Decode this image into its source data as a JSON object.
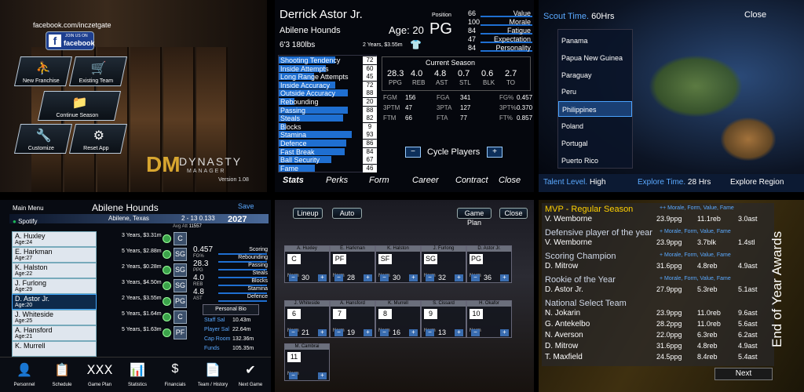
{
  "panel1": {
    "url": "facebook.com/inczetgate",
    "join": "JOIN US ON",
    "fb": "facebook",
    "buttons": [
      "New Franchise",
      "Existing Team",
      "Continue Season",
      "Customize",
      "Reset App"
    ],
    "logo_word": "DYNASTY",
    "logo_sub": "MANAGER",
    "version": "Version 1.08"
  },
  "panel2": {
    "name": "Derrick Astor Jr.",
    "team": "Abilene Hounds",
    "age_label": "Age:",
    "age": "20",
    "pos_label": "Position",
    "pos": "PG",
    "height_weight": "6'3  180lbs",
    "contract": "2 Years, $3.55m",
    "ratings": [
      {
        "label": "Value",
        "value": "66"
      },
      {
        "label": "Morale",
        "value": "100"
      },
      {
        "label": "Fatigue",
        "value": "84"
      },
      {
        "label": "Expectation",
        "value": "47"
      },
      {
        "label": "Personality",
        "value": "84"
      }
    ],
    "skills": [
      {
        "label": "Shooting Tendency",
        "value": 72
      },
      {
        "label": "Inside Attempts",
        "value": 60
      },
      {
        "label": "Long Range Attempts",
        "value": 45
      },
      {
        "label": "Inside Accuracy",
        "value": 72
      },
      {
        "label": "Outside Accuracy",
        "value": 88
      },
      {
        "label": "Rebounding",
        "value": 20
      },
      {
        "label": "Passing",
        "value": 88
      },
      {
        "label": "Steals",
        "value": 82
      },
      {
        "label": "Blocks",
        "value": 9
      },
      {
        "label": "Stamina",
        "value": 93
      },
      {
        "label": "Defence",
        "value": 86
      },
      {
        "label": "Fast Break",
        "value": 84
      },
      {
        "label": "Ball Security",
        "value": 67
      },
      {
        "label": "Fame",
        "value": 46
      }
    ],
    "season_title": "Current Season",
    "season_stats": [
      {
        "v": "28.3",
        "l": "PPG"
      },
      {
        "v": "4.0",
        "l": "REB"
      },
      {
        "v": "4.8",
        "l": "AST"
      },
      {
        "v": "0.7",
        "l": "STL"
      },
      {
        "v": "0.6",
        "l": "BLK"
      },
      {
        "v": "2.7",
        "l": "TO"
      }
    ],
    "shooting": [
      [
        "FGM",
        "156",
        "FGA",
        "341",
        "FG%",
        "0.457"
      ],
      [
        "3PTM",
        "47",
        "3PTA",
        "127",
        "3PT%",
        "0.370"
      ],
      [
        "FTM",
        "66",
        "FTA",
        "77",
        "FT%",
        "0.857"
      ]
    ],
    "cycle": "Cycle Players",
    "tabs": [
      "Stats",
      "Perks",
      "Form",
      "Career",
      "Contract",
      "Close"
    ]
  },
  "panel3": {
    "scout_label": "Scout Time.",
    "scout_value": "60Hrs",
    "close": "Close",
    "countries": [
      "Panama",
      "Papua New Guinea",
      "Paraguay",
      "Peru",
      "Philippines",
      "Poland",
      "Portugal",
      "Puerto Rico"
    ],
    "selected": "Philippines",
    "talent_label": "Talent Level.",
    "talent_value": "High",
    "explore_label": "Explore Time.",
    "explore_value": "28 Hrs",
    "explore_btn": "Explore Region"
  },
  "panel4": {
    "main_menu": "Main Menu",
    "team": "Abilene Hounds",
    "save": "Save",
    "city": "Abilene, Texas",
    "record": "2 - 13  0.133",
    "year": "2027",
    "att_label": "Avg Att",
    "att": "11557",
    "spotify": "Spotify",
    "players": [
      {
        "name": "A. Huxley",
        "age": "Age:24",
        "contract": "3 Years, $3.31m",
        "pos": "C"
      },
      {
        "name": "E. Harkman",
        "age": "Age:27",
        "contract": "5 Years, $2.88m",
        "pos": "SG"
      },
      {
        "name": "K. Halston",
        "age": "Age:22",
        "contract": "2 Years, $0.28m",
        "pos": "SG"
      },
      {
        "name": "J. Furlong",
        "age": "Age:29",
        "contract": "3 Years, $4.50m",
        "pos": "SG"
      },
      {
        "name": "D. Astor Jr.",
        "age": "Age:20",
        "contract": "2 Years, $3.55m",
        "pos": "PG"
      },
      {
        "name": "J. Whiteside",
        "age": "Age:25",
        "contract": "5 Years, $1.64m",
        "pos": "C"
      },
      {
        "name": "A. Hansford",
        "age": "Age:21",
        "contract": "5 Years, $1.63m",
        "pos": "PF"
      },
      {
        "name": "K. Murrell",
        "age": "",
        "contract": "",
        "pos": ""
      }
    ],
    "stats": [
      {
        "v": "0.457",
        "l": "FG%"
      },
      {
        "v": "28.3",
        "l": "PPG"
      },
      {
        "v": "4.0",
        "l": "REB"
      },
      {
        "v": "4.8",
        "l": "AST"
      }
    ],
    "bars": [
      "Scoring",
      "Rebounding",
      "Passing",
      "Steals",
      "Blocks",
      "Stamina",
      "Defence"
    ],
    "bio": "Personal Bio",
    "fin": [
      {
        "l": "Staff Sal",
        "v": "10.43m"
      },
      {
        "l": "Player Sal",
        "v": "22.64m"
      },
      {
        "l": "Cap Room",
        "v": "132.36m"
      },
      {
        "l": "Funds",
        "v": "105.35m"
      }
    ],
    "nav": [
      "Personnel",
      "Schedule",
      "Game Plan",
      "Statistics",
      "Financials",
      "Team / History",
      "Next Game"
    ]
  },
  "panel5": {
    "lineup": "Lineup",
    "auto": "Auto",
    "gameplan": "Game Plan",
    "close": "Close",
    "cards": [
      {
        "name": "A. Huxley",
        "num": "C",
        "pos": "",
        "norm": "Norm",
        "val": "30"
      },
      {
        "name": "E. Harkman",
        "num": "PF",
        "pos": "",
        "norm": "Norm",
        "val": "28"
      },
      {
        "name": "K. Halston",
        "num": "SF",
        "pos": "",
        "norm": "Norm",
        "val": "30"
      },
      {
        "name": "J. Furlong",
        "num": "SG",
        "pos": "",
        "norm": "Norm",
        "val": "32"
      },
      {
        "name": "D. Astor Jr.",
        "num": "PG",
        "pos": "",
        "norm": "Norm",
        "val": "36"
      },
      {
        "name": "J. Whiteside",
        "num": "6",
        "pos": "",
        "norm": "Norm",
        "val": "21"
      },
      {
        "name": "A. Hansford",
        "num": "7",
        "pos": "",
        "norm": "Norm",
        "val": "19"
      },
      {
        "name": "K. Murrell",
        "num": "8",
        "pos": "",
        "norm": "Norm",
        "val": "16"
      },
      {
        "name": "S. Cissard",
        "num": "9",
        "pos": "",
        "norm": "Norm",
        "val": "13"
      },
      {
        "name": "H. Okafor",
        "num": "10",
        "pos": "",
        "norm": "Norm",
        "val": ""
      },
      {
        "name": "M. Cambrai",
        "num": "11",
        "pos": "",
        "norm": "Norm",
        "val": ""
      }
    ]
  },
  "panel6": {
    "title": "End of Year Awards",
    "next": "Next",
    "awards": [
      {
        "title": "MVP - Regular Season",
        "bonus": "++ Morale, Form, Value, Fame",
        "rows": [
          [
            "V. Wemborne",
            "23.9ppg",
            "11.1reb",
            "3.0ast"
          ]
        ]
      },
      {
        "title": "Defensive player of the year",
        "bonus": "+ Morale, Form, Value, Fame",
        "rows": [
          [
            "V. Wemborne",
            "23.9ppg",
            "3.7blk",
            "1.4stl"
          ]
        ]
      },
      {
        "title": "Scoring Champion",
        "bonus": "+ Morale, Form, Value, Fame",
        "rows": [
          [
            "D. Mitrow",
            "31.6ppg",
            "4.8reb",
            "4.9ast"
          ]
        ]
      },
      {
        "title": "Rookie of the Year",
        "bonus": "+ Morale, Form, Value, Fame",
        "rows": [
          [
            "D. Astor Jr.",
            "27.9ppg",
            "5.3reb",
            "5.1ast"
          ]
        ]
      },
      {
        "title": "National Select Team",
        "bonus": "",
        "rows": [
          [
            "N. Jokarin",
            "23.9ppg",
            "11.0reb",
            "9.6ast"
          ],
          [
            "G. Antekelbo",
            "28.2ppg",
            "11.0reb",
            "5.6ast"
          ],
          [
            "N. Averson",
            "22.0ppg",
            "6.3reb",
            "6.2ast"
          ],
          [
            "D. Mitrow",
            "31.6ppg",
            "4.8reb",
            "4.9ast"
          ],
          [
            "T. Maxfield",
            "24.5ppg",
            "8.4reb",
            "5.4ast"
          ]
        ]
      }
    ]
  }
}
